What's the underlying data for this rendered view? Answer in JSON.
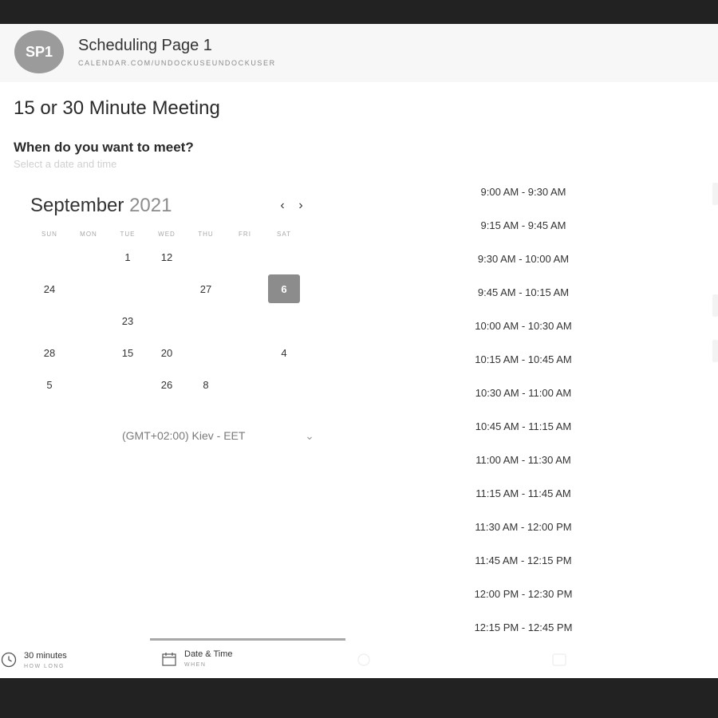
{
  "header": {
    "avatar_initials": "SP1",
    "page_name": "Scheduling Page 1",
    "page_url": "CALENDAR.COM/UNDOCKUSEUNDOCKUSER"
  },
  "meeting": {
    "title": "15 or 30 Minute Meeting",
    "question": "When do you want to meet?",
    "hint": "Select a date and time"
  },
  "calendar": {
    "month": "September",
    "year": "2021",
    "prev_icon": "chevron-left-icon",
    "next_icon": "chevron-right-icon",
    "weekdays": [
      "SUN",
      "MON",
      "TUE",
      "WED",
      "THU",
      "FRI",
      "SAT"
    ],
    "weeks": [
      [
        {
          "t": "",
          "m": true
        },
        {
          "t": "",
          "m": true
        },
        {
          "t": "1",
          "m": false
        },
        {
          "t": "12",
          "m": false
        },
        {
          "t": "",
          "m": true
        },
        {
          "t": "",
          "m": true
        },
        {
          "t": "",
          "m": true
        }
      ],
      [
        {
          "t": "24",
          "m": false
        },
        {
          "t": "",
          "m": true
        },
        {
          "t": "",
          "m": true
        },
        {
          "t": "",
          "m": true
        },
        {
          "t": "27",
          "m": false
        },
        {
          "t": "",
          "m": true
        },
        {
          "t": "6",
          "m": false,
          "sel": true
        }
      ],
      [
        {
          "t": "",
          "m": true
        },
        {
          "t": "",
          "m": true
        },
        {
          "t": "23",
          "m": false
        },
        {
          "t": "",
          "m": true
        },
        {
          "t": "",
          "m": true
        },
        {
          "t": "",
          "m": true
        },
        {
          "t": "",
          "m": true
        }
      ],
      [
        {
          "t": "28",
          "m": false
        },
        {
          "t": "",
          "m": true
        },
        {
          "t": "15",
          "m": false
        },
        {
          "t": "20",
          "m": false
        },
        {
          "t": "",
          "m": true
        },
        {
          "t": "",
          "m": true
        },
        {
          "t": "4",
          "m": false
        }
      ],
      [
        {
          "t": "5",
          "m": false
        },
        {
          "t": "",
          "m": true
        },
        {
          "t": "",
          "m": true
        },
        {
          "t": "26",
          "m": false
        },
        {
          "t": "8",
          "m": false
        },
        {
          "t": "",
          "m": true
        },
        {
          "t": "",
          "m": true
        }
      ]
    ],
    "timezone": "(GMT+02:00) Kiev - EET",
    "timezone_icon": "chevron-down-icon"
  },
  "time_slots": [
    "9:00 AM - 9:30 AM",
    "9:15 AM - 9:45 AM",
    "9:30 AM - 10:00 AM",
    "9:45 AM - 10:15 AM",
    "10:00 AM - 10:30 AM",
    "10:15 AM - 10:45 AM",
    "10:30 AM - 11:00 AM",
    "10:45 AM - 11:15 AM",
    "11:00 AM - 11:30 AM",
    "11:15 AM - 11:45 AM",
    "11:30 AM - 12:00 PM",
    "11:45 AM - 12:15 PM",
    "12:00 PM - 12:30 PM",
    "12:15 PM - 12:45 PM"
  ],
  "steps": [
    {
      "label": "30 minutes",
      "sub": "HOW LONG",
      "icon": "clock-icon"
    },
    {
      "label": "Date & Time",
      "sub": "WHEN",
      "icon": "calendar-icon"
    }
  ]
}
